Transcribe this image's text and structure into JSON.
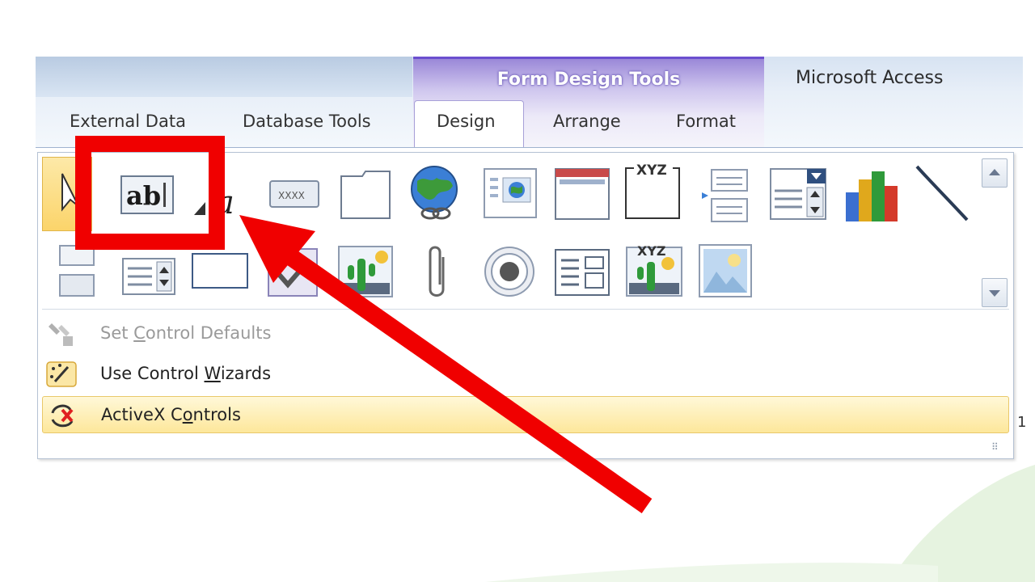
{
  "ribbon": {
    "context_group_title": "Form Design Tools",
    "app_title": "Microsoft Access",
    "tabs": [
      {
        "label": "External Data"
      },
      {
        "label": "Database Tools"
      },
      {
        "label": "Design"
      },
      {
        "label": "Arrange"
      },
      {
        "label": "Format"
      }
    ]
  },
  "gallery": {
    "textbox_glyph": "ab",
    "label_glyph": "a",
    "button_glyph": "XXXX",
    "xyz_glyph": "XYZ",
    "xyz2_glyph": "XYZ"
  },
  "menu": {
    "items": [
      {
        "label": "Set Control Defaults",
        "mnemonic_char": "C"
      },
      {
        "label": "Use Control Wizards",
        "mnemonic_char": "W"
      },
      {
        "label": "ActiveX Controls",
        "mnemonic_char": "o"
      }
    ]
  },
  "edge": {
    "right_char": "1"
  },
  "colors": {
    "annotation_red": "#f00000",
    "context_accent": "#6b4fcf",
    "highlight": "#fbd46a"
  }
}
